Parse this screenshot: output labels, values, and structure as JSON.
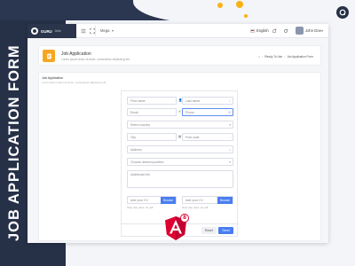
{
  "poster": {
    "vertical_title": "JOB APPLICATION FORM",
    "colors": {
      "navy": "#263148",
      "accent": "#f9b116",
      "angular_red": "#dd0031",
      "primary_blue": "#4a7df0"
    },
    "framework_badge": "8"
  },
  "topbar": {
    "brand_name": "GURU",
    "brand_sub": "Able",
    "menu_label": "Mega",
    "language": "English",
    "user_name": "John Doe",
    "icons": [
      "menu-icon",
      "expand-icon",
      "flag-icon",
      "bell-icon",
      "settings-icon",
      "avatar"
    ]
  },
  "header": {
    "title": "Job Application",
    "description": "Lorem ipsum dolor sit amet, consectetur adipiscing elit",
    "breadcrumbs": [
      "Ready To Use",
      "Job Application Form"
    ]
  },
  "form_card": {
    "title": "Job Application",
    "description": "Lorem ipsum dolor sit amet, consectetur adipiscing elit",
    "fields": {
      "first_name": "First name",
      "last_name": "Last name",
      "email": "Email",
      "phone": "Phone",
      "country": "Select country",
      "city": "City",
      "post_code": "Post code",
      "address": "Address",
      "position": "Choose desired position",
      "additional_info": "Additional info",
      "cv": "Add your CV",
      "cover_letter": "Add your CV"
    },
    "browse_label": "Browse",
    "file_hint": "Only: doc, docx, txt, pdf",
    "buttons": {
      "reset": "Reset",
      "send": "Send"
    }
  }
}
